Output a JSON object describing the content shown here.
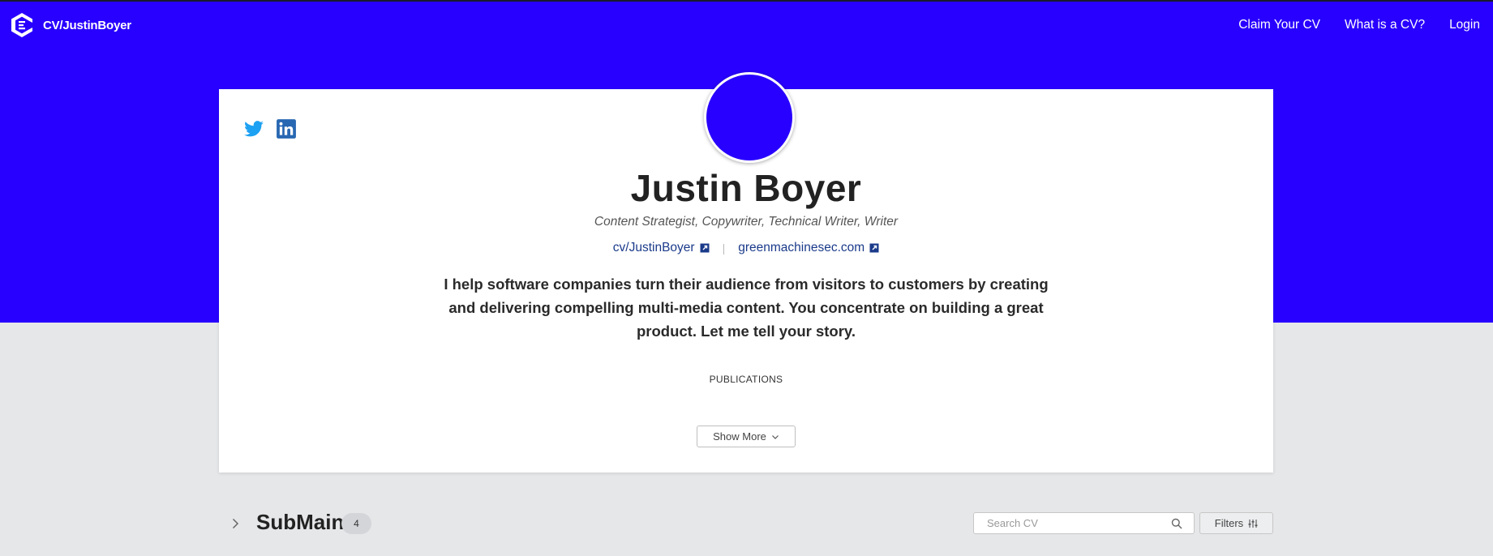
{
  "colors": {
    "brand": "#2800ff",
    "link": "#1a3a8a",
    "twitter": "#1da1f2",
    "linkedin": "#2867b2"
  },
  "topnav": {
    "brand_text": "CV/JustinBoyer",
    "logo_icon": "cv-logo-icon",
    "links": [
      "Claim Your CV",
      "What is a CV?",
      "Login"
    ]
  },
  "profile": {
    "social": [
      "twitter-icon",
      "linkedin-icon"
    ],
    "name": "Justin Boyer",
    "roles": "Content Strategist, Copywriter, Technical Writer, Writer",
    "links": [
      {
        "label": "cv/JustinBoyer",
        "icon": "external-link-icon"
      },
      {
        "label": "greenmachinesec.com",
        "icon": "external-link-icon"
      }
    ],
    "link_separator": "|",
    "bio": "I help software companies turn their audience from visitors to customers by creating and delivering compelling multi-media content. You concentrate on building a great product. Let me tell your story.",
    "section_label": "PUBLICATIONS",
    "show_more": "Show More"
  },
  "section": {
    "title": "SubMain",
    "count": "4",
    "search_placeholder": "Search CV",
    "filters_label": "Filters"
  }
}
